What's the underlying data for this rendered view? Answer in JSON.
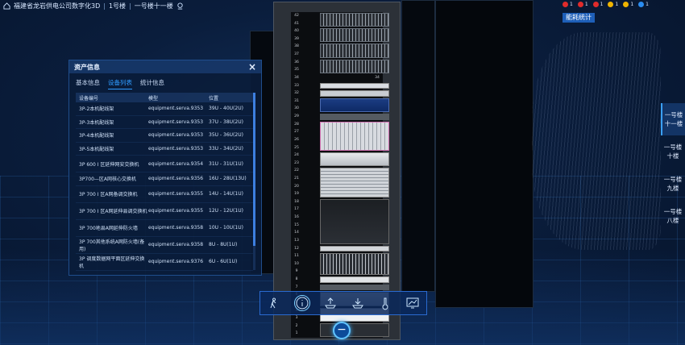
{
  "topbar": {
    "crumb1": "福建省龙岩供电公司数字化3D",
    "crumb2": "1号楼",
    "crumb3": "一号楼十一楼"
  },
  "alarms": [
    {
      "color": "#e02b2b",
      "count": "1"
    },
    {
      "color": "#e02b2b",
      "count": "1"
    },
    {
      "color": "#e02b2b",
      "count": "1"
    },
    {
      "color": "#f0b400",
      "count": "1"
    },
    {
      "color": "#f0b400",
      "count": "1"
    },
    {
      "color": "#2a8cf0",
      "count": "1"
    }
  ],
  "energy_button": "能耗统计",
  "panel": {
    "title": "资产信息",
    "tabs": [
      "基本信息",
      "设备列表",
      "统计信息"
    ],
    "active_tab": 1,
    "columns": [
      "设备编号",
      "模型",
      "位置"
    ],
    "rows": [
      {
        "id": "3P-2本机配线架",
        "model": "equipment.serva.9353",
        "pos": "39U - 40U(2U)"
      },
      {
        "id": "3P-3本机配线架",
        "model": "equipment.serva.9353",
        "pos": "37U - 38U(2U)"
      },
      {
        "id": "3P-4本机配线架",
        "model": "equipment.serva.9353",
        "pos": "35U - 36U(2U)"
      },
      {
        "id": "3P-5本机配线架",
        "model": "equipment.serva.9353",
        "pos": "33U - 34U(2U)"
      },
      {
        "id": "3P 600 I 区延伸网安交换机",
        "model": "equipment.serva.9354",
        "pos": "31U - 31U(1U)"
      },
      {
        "id": "3P700—区A网核心交换机",
        "model": "equipment.serva.9356",
        "pos": "16U - 28U(13U)"
      },
      {
        "id": "3P 700 I 区A网备调交换机",
        "model": "equipment.serva.9355",
        "pos": "14U - 14U(1U)"
      },
      {
        "id": "3P 700 I 区A网延伸县调交换机",
        "model": "equipment.serva.9355",
        "pos": "12U - 12U(1U)"
      },
      {
        "id": "3P 700地县A网延伸防火墙",
        "model": "equipment.serva.9358",
        "pos": "10U - 10U(1U)"
      },
      {
        "id": "3P 700其他系统A网防火墙(备用)",
        "model": "equipment.serva.9358",
        "pos": "8U - 8U(1U)"
      },
      {
        "id": "3P 调度数据网平面区延伸交换机",
        "model": "equipment.serva.9376",
        "pos": "6U - 6U(1U)"
      }
    ]
  },
  "floors": [
    "一号楼十一楼",
    "一号楼十楼",
    "一号楼九楼",
    "一号楼八楼"
  ],
  "floor_active": 0,
  "toolbar": [
    "walk-icon",
    "info-icon",
    "upload-icon",
    "download-icon",
    "temperature-icon",
    "monitor-icon"
  ],
  "toolbar_active": 1,
  "rack_units": 42,
  "zoom_symbol": "−"
}
